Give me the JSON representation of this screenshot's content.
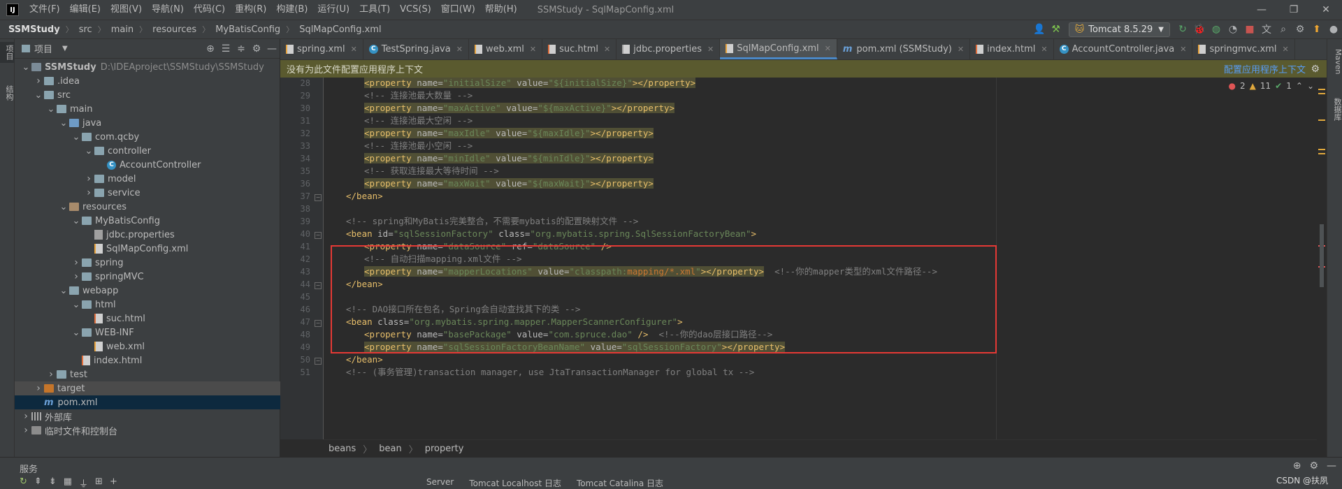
{
  "menubar": {
    "logo": "IJ",
    "items": [
      "文件(F)",
      "编辑(E)",
      "视图(V)",
      "导航(N)",
      "代码(C)",
      "重构(R)",
      "构建(B)",
      "运行(U)",
      "工具(T)",
      "VCS(S)",
      "窗口(W)",
      "帮助(H)"
    ],
    "title": "SSMStudy - SqlMapConfig.xml",
    "controls": [
      "—",
      "❐",
      "✕"
    ]
  },
  "navbar": {
    "crumbs": [
      "SSMStudy",
      "src",
      "main",
      "resources",
      "MyBatisConfig",
      "SqlMapConfig.xml"
    ],
    "run_config": "Tomcat 8.5.29"
  },
  "left_strip": {
    "tabs": [
      "项目",
      "结构"
    ]
  },
  "right_strip": {
    "tabs": [
      "Maven",
      "数据库"
    ]
  },
  "project": {
    "title": "项目",
    "tree": [
      {
        "label": "SSMStudy",
        "extra": "D:\\IDEAproject\\SSMStudy\\SSMStudy",
        "depth": 0,
        "icon": "module",
        "chevron": "open",
        "bold": true
      },
      {
        "label": ".idea",
        "depth": 1,
        "icon": "folder",
        "chevron": "closed"
      },
      {
        "label": "src",
        "depth": 1,
        "icon": "folder",
        "chevron": "open"
      },
      {
        "label": "main",
        "depth": 2,
        "icon": "folder",
        "chevron": "open"
      },
      {
        "label": "java",
        "depth": 3,
        "icon": "src",
        "chevron": "open"
      },
      {
        "label": "com.qcby",
        "depth": 4,
        "icon": "folder",
        "chevron": "open"
      },
      {
        "label": "controller",
        "depth": 5,
        "icon": "folder",
        "chevron": "open"
      },
      {
        "label": "AccountController",
        "depth": 6,
        "icon": "java",
        "chevron": "none"
      },
      {
        "label": "model",
        "depth": 5,
        "icon": "folder",
        "chevron": "closed"
      },
      {
        "label": "service",
        "depth": 5,
        "icon": "folder",
        "chevron": "closed"
      },
      {
        "label": "resources",
        "depth": 3,
        "icon": "res",
        "chevron": "open"
      },
      {
        "label": "MyBatisConfig",
        "depth": 4,
        "icon": "folder",
        "chevron": "open"
      },
      {
        "label": "jdbc.properties",
        "depth": 5,
        "icon": "prop",
        "chevron": "none"
      },
      {
        "label": "SqlMapConfig.xml",
        "depth": 5,
        "icon": "xml",
        "chevron": "none"
      },
      {
        "label": "spring",
        "depth": 4,
        "icon": "folder",
        "chevron": "closed"
      },
      {
        "label": "springMVC",
        "depth": 4,
        "icon": "folder",
        "chevron": "closed"
      },
      {
        "label": "webapp",
        "depth": 3,
        "icon": "folder",
        "chevron": "open"
      },
      {
        "label": "html",
        "depth": 4,
        "icon": "folder",
        "chevron": "open"
      },
      {
        "label": "suc.html",
        "depth": 5,
        "icon": "html",
        "chevron": "none"
      },
      {
        "label": "WEB-INF",
        "depth": 4,
        "icon": "folder",
        "chevron": "open"
      },
      {
        "label": "web.xml",
        "depth": 5,
        "icon": "xml",
        "chevron": "none"
      },
      {
        "label": "index.html",
        "depth": 4,
        "icon": "html",
        "chevron": "none"
      },
      {
        "label": "test",
        "depth": 2,
        "icon": "folder",
        "chevron": "closed"
      },
      {
        "label": "target",
        "depth": 1,
        "icon": "orange",
        "chevron": "closed",
        "state": "hover"
      },
      {
        "label": "pom.xml",
        "depth": 1,
        "icon": "m",
        "chevron": "none",
        "state": "selected"
      },
      {
        "label": "外部库",
        "depth": 0,
        "icon": "lib",
        "chevron": "closed"
      },
      {
        "label": "临时文件和控制台",
        "depth": 0,
        "icon": "scratch",
        "chevron": "closed"
      }
    ]
  },
  "tabs": [
    {
      "label": "spring.xml",
      "icon": "xml"
    },
    {
      "label": "TestSpring.java",
      "icon": "java"
    },
    {
      "label": "web.xml",
      "icon": "xml"
    },
    {
      "label": "suc.html",
      "icon": "html"
    },
    {
      "label": "jdbc.properties",
      "icon": "prop"
    },
    {
      "label": "SqlMapConfig.xml",
      "icon": "xml",
      "active": true
    },
    {
      "label": "pom.xml (SSMStudy)",
      "icon": "m"
    },
    {
      "label": "index.html",
      "icon": "html"
    },
    {
      "label": "AccountController.java",
      "icon": "java"
    },
    {
      "label": "springmvc.xml",
      "icon": "xml"
    }
  ],
  "banner": {
    "text": "没有为此文件配置应用程序上下文",
    "link": "配置应用程序上下文"
  },
  "inspections": {
    "errors": "2",
    "warnings": "11",
    "ok": "1"
  },
  "code_lines": [
    {
      "n": "28",
      "indent": 8,
      "hl": true,
      "tokens": [
        [
          "tag",
          "<property "
        ],
        [
          "attr",
          "name="
        ],
        [
          "val",
          "\"initialSize\""
        ],
        [
          "attr",
          " value="
        ],
        [
          "val",
          "\"${initialSize}\""
        ],
        [
          "tag",
          "></property>"
        ]
      ]
    },
    {
      "n": "29",
      "indent": 8,
      "tokens": [
        [
          "com",
          "<!-- 连接池最大数量 -->"
        ]
      ]
    },
    {
      "n": "30",
      "indent": 8,
      "hl": true,
      "tokens": [
        [
          "tag",
          "<property "
        ],
        [
          "attr",
          "name="
        ],
        [
          "val",
          "\"maxActive\""
        ],
        [
          "attr",
          " value="
        ],
        [
          "val",
          "\"${maxActive}\""
        ],
        [
          "tag",
          "></property>"
        ]
      ]
    },
    {
      "n": "31",
      "indent": 8,
      "tokens": [
        [
          "com",
          "<!-- 连接池最大空闲 -->"
        ]
      ]
    },
    {
      "n": "32",
      "indent": 8,
      "hl": true,
      "tokens": [
        [
          "tag",
          "<property "
        ],
        [
          "attr",
          "name="
        ],
        [
          "val",
          "\"maxIdle\""
        ],
        [
          "attr",
          " value="
        ],
        [
          "val",
          "\"${maxIdle}\""
        ],
        [
          "tag",
          "></property>"
        ]
      ]
    },
    {
      "n": "33",
      "indent": 8,
      "tokens": [
        [
          "com",
          "<!-- 连接池最小空闲 -->"
        ]
      ]
    },
    {
      "n": "34",
      "indent": 8,
      "hl": true,
      "tokens": [
        [
          "tag",
          "<property "
        ],
        [
          "attr",
          "name="
        ],
        [
          "val",
          "\"minIdle\""
        ],
        [
          "attr",
          " value="
        ],
        [
          "val",
          "\"${minIdle}\""
        ],
        [
          "tag",
          "></property>"
        ]
      ]
    },
    {
      "n": "35",
      "indent": 8,
      "tokens": [
        [
          "com",
          "<!-- 获取连接最大等待时间 -->"
        ]
      ]
    },
    {
      "n": "36",
      "indent": 8,
      "hl": true,
      "tokens": [
        [
          "tag",
          "<property "
        ],
        [
          "attr",
          "name="
        ],
        [
          "val",
          "\"maxWait\""
        ],
        [
          "attr",
          " value="
        ],
        [
          "val",
          "\"${maxWait}\""
        ],
        [
          "tag",
          "></property>"
        ]
      ]
    },
    {
      "n": "37",
      "indent": 4,
      "fold": true,
      "tokens": [
        [
          "tag",
          "</bean>"
        ]
      ]
    },
    {
      "n": "38",
      "indent": 0,
      "tokens": []
    },
    {
      "n": "39",
      "indent": 4,
      "tokens": [
        [
          "com",
          "<!-- spring和MyBatis完美整合，不需要mybatis的配置映射文件 -->"
        ]
      ]
    },
    {
      "n": "40",
      "indent": 4,
      "fold": true,
      "tokens": [
        [
          "tag",
          "<bean "
        ],
        [
          "attr",
          "id="
        ],
        [
          "val",
          "\"sqlSessionFactory\""
        ],
        [
          "attr",
          " class="
        ],
        [
          "val",
          "\"org.mybatis.spring.SqlSessionFactoryBean\""
        ],
        [
          "tag",
          ">"
        ]
      ]
    },
    {
      "n": "41",
      "indent": 8,
      "tokens": [
        [
          "tag",
          "<property "
        ],
        [
          "attr",
          "name="
        ],
        [
          "val",
          "\"dataSource\""
        ],
        [
          "attr",
          " ref="
        ],
        [
          "val",
          "\"dataSource\""
        ],
        [
          "tag",
          " />"
        ]
      ]
    },
    {
      "n": "42",
      "indent": 8,
      "tokens": [
        [
          "com",
          "<!-- 自动扫描mapping.xml文件 -->"
        ]
      ]
    },
    {
      "n": "43",
      "indent": 8,
      "hl": true,
      "tokens": [
        [
          "tag",
          "<property "
        ],
        [
          "attr",
          "name="
        ],
        [
          "val",
          "\"mapperLocations\""
        ],
        [
          "attr",
          " value="
        ],
        [
          "val",
          "\"classpath:"
        ],
        [
          "red",
          "mapping/*.xml"
        ],
        [
          "val",
          "\""
        ],
        [
          "tag",
          "></property>"
        ],
        [
          "com",
          "  <!--你的mapper类型的xml文件路径-->"
        ]
      ]
    },
    {
      "n": "44",
      "indent": 4,
      "fold": true,
      "tokens": [
        [
          "tag",
          "</bean>"
        ]
      ]
    },
    {
      "n": "45",
      "indent": 0,
      "tokens": []
    },
    {
      "n": "46",
      "indent": 4,
      "tokens": [
        [
          "com",
          "<!-- DAO接口所在包名，Spring会自动查找其下的类 -->"
        ]
      ]
    },
    {
      "n": "47",
      "indent": 4,
      "fold": true,
      "tokens": [
        [
          "tag",
          "<bean "
        ],
        [
          "attr",
          "class="
        ],
        [
          "val",
          "\"org.mybatis.spring.mapper.MapperScannerConfigurer\""
        ],
        [
          "tag",
          ">"
        ]
      ]
    },
    {
      "n": "48",
      "indent": 8,
      "tokens": [
        [
          "tag",
          "<property "
        ],
        [
          "attr",
          "name="
        ],
        [
          "val",
          "\"basePackage\""
        ],
        [
          "attr",
          " value="
        ],
        [
          "val",
          "\"com.spruce.dao\""
        ],
        [
          "tag",
          " />"
        ],
        [
          "com",
          "  <!--你的dao层接口路径-->"
        ]
      ]
    },
    {
      "n": "49",
      "indent": 8,
      "hl": true,
      "tokens": [
        [
          "tag",
          "<property "
        ],
        [
          "attr",
          "name="
        ],
        [
          "val",
          "\"sqlSessionFactoryBeanName\""
        ],
        [
          "attr",
          " value="
        ],
        [
          "val",
          "\"sqlSessionFactory\""
        ],
        [
          "tag",
          "></property>"
        ]
      ]
    },
    {
      "n": "50",
      "indent": 4,
      "fold": true,
      "tokens": [
        [
          "tag",
          "</bean>"
        ]
      ]
    },
    {
      "n": "51",
      "indent": 4,
      "tokens": [
        [
          "com",
          "<!-- (事务管理)transaction manager, use JtaTransactionManager for global tx -->"
        ]
      ]
    }
  ],
  "editor_crumbs": [
    "beans",
    "bean",
    "property"
  ],
  "services": {
    "title": "服务",
    "tabs": [
      "Server",
      "Tomcat Localhost 日志",
      "Tomcat Catalina 日志"
    ],
    "watermark": "CSDN @扶夙"
  },
  "colors": {
    "accent": "#4a88c7",
    "highlight_box": "#e53935",
    "banner_bg": "#5a5a2f"
  }
}
